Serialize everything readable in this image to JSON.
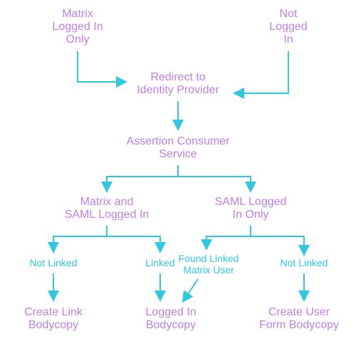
{
  "nodes": {
    "matrix_only_l1": "Matrix",
    "matrix_only_l2": "Logged In",
    "matrix_only_l3": "Only",
    "not_logged_l1": "Not",
    "not_logged_l2": "Logged",
    "not_logged_l3": "In",
    "redirect_l1": "Redirect to",
    "redirect_l2": "Identity Provider",
    "acs_l1": "Assertion Consumer",
    "acs_l2": "Service",
    "matrix_saml_l1": "Matrix and",
    "matrix_saml_l2": "SAML Logged In",
    "saml_only_l1": "SAML Logged",
    "saml_only_l2": "In Only",
    "create_link_l1": "Create Link",
    "create_link_l2": "Bodycopy",
    "logged_in_l1": "Logged In",
    "logged_in_l2": "Bodycopy",
    "create_user_l1": "Create User",
    "create_user_l2": "Form Bodycopy"
  },
  "edges": {
    "not_linked_left": "Not Linked",
    "linked": "Linked",
    "found_linked_l1": "Found Linked",
    "found_linked_l2": "Matrix User",
    "not_linked_right": "Not Linked"
  }
}
